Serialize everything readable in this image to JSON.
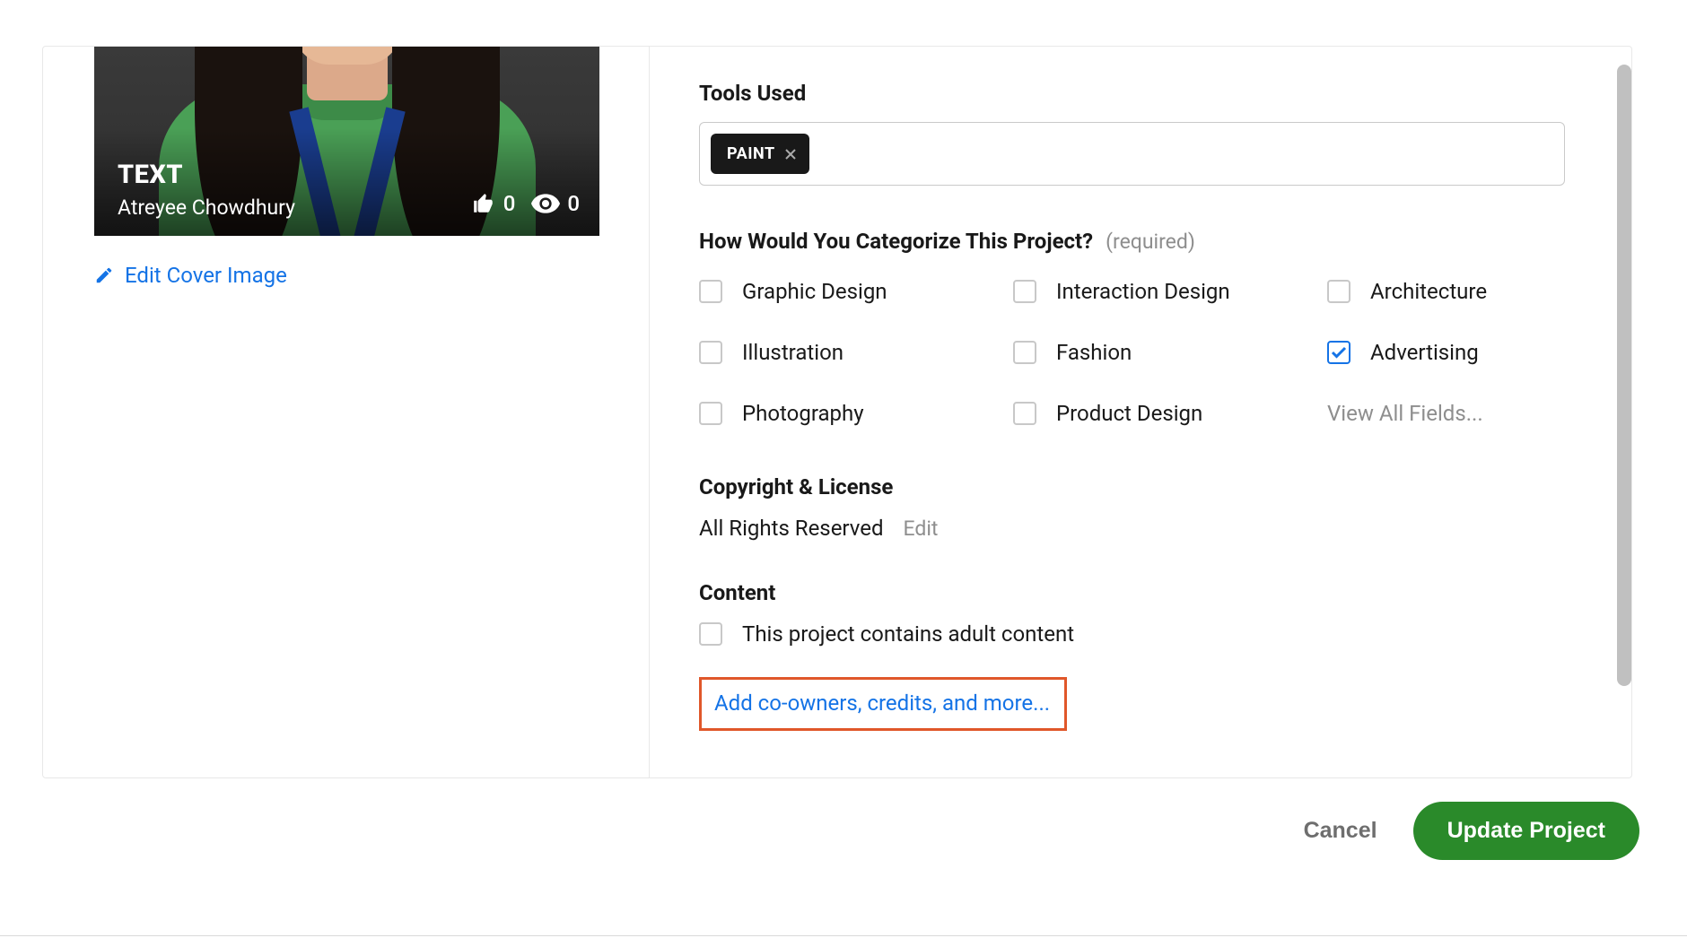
{
  "cover": {
    "title": "TEXT",
    "author": "Atreyee Chowdhury",
    "likes": "0",
    "views": "0",
    "edit_label": "Edit Cover Image"
  },
  "tools": {
    "label": "Tools Used",
    "tags": [
      "PAINT"
    ]
  },
  "categorize": {
    "label": "How Would You Categorize This Project?",
    "required": "(required)",
    "items": [
      {
        "label": "Graphic Design",
        "checked": false
      },
      {
        "label": "Interaction Design",
        "checked": false
      },
      {
        "label": "Architecture",
        "checked": false
      },
      {
        "label": "Illustration",
        "checked": false
      },
      {
        "label": "Fashion",
        "checked": false
      },
      {
        "label": "Advertising",
        "checked": true
      },
      {
        "label": "Photography",
        "checked": false
      },
      {
        "label": "Product Design",
        "checked": false
      }
    ],
    "view_all": "View All Fields..."
  },
  "license": {
    "label": "Copyright & License",
    "value": "All Rights Reserved",
    "edit": "Edit"
  },
  "content": {
    "label": "Content",
    "adult_label": "This project contains adult content",
    "adult_checked": false,
    "add_more": "Add co-owners, credits, and more..."
  },
  "footer": {
    "cancel": "Cancel",
    "update": "Update Project"
  }
}
